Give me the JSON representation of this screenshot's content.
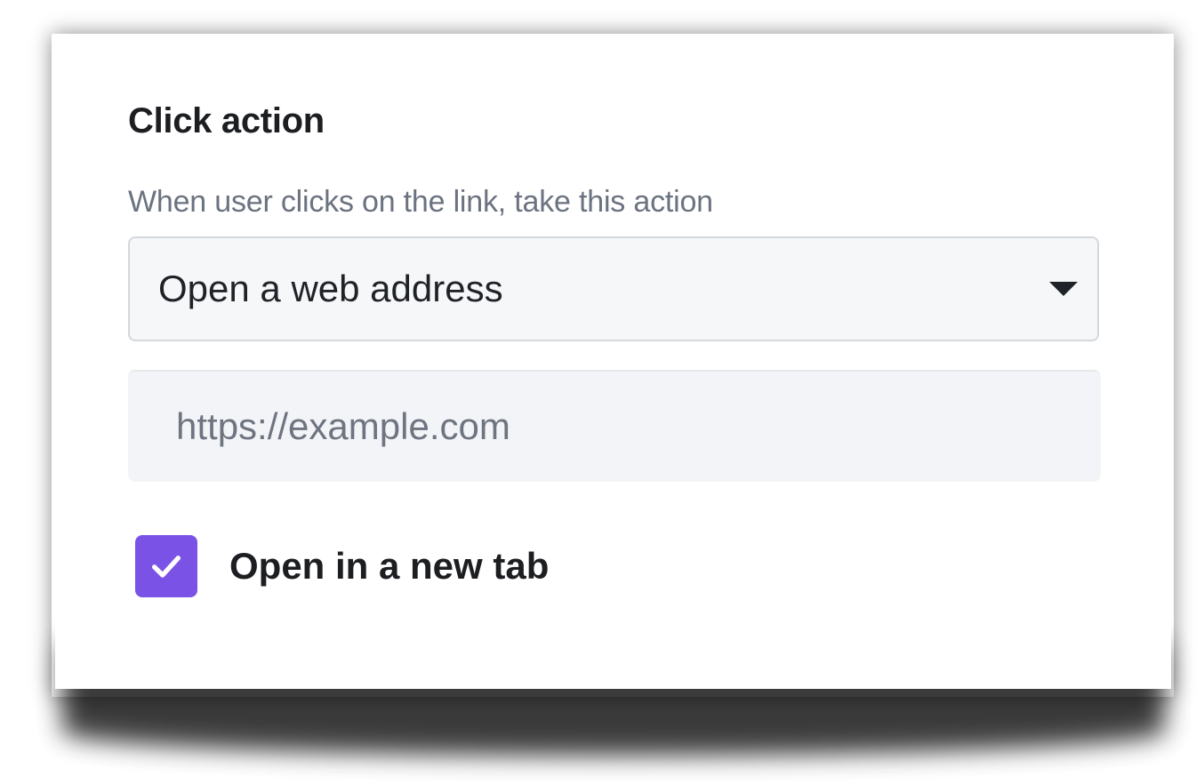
{
  "section": {
    "title": "Click action",
    "description": "When user clicks on the link, take this action"
  },
  "action_select": {
    "value": "Open a web address",
    "icon": "chevron-down-icon"
  },
  "url_field": {
    "value": "",
    "placeholder": "https://example.com"
  },
  "new_tab_option": {
    "label": "Open in a new tab",
    "checked": true,
    "accent_color": "#7b52e6",
    "icon": "checkmark-icon"
  }
}
